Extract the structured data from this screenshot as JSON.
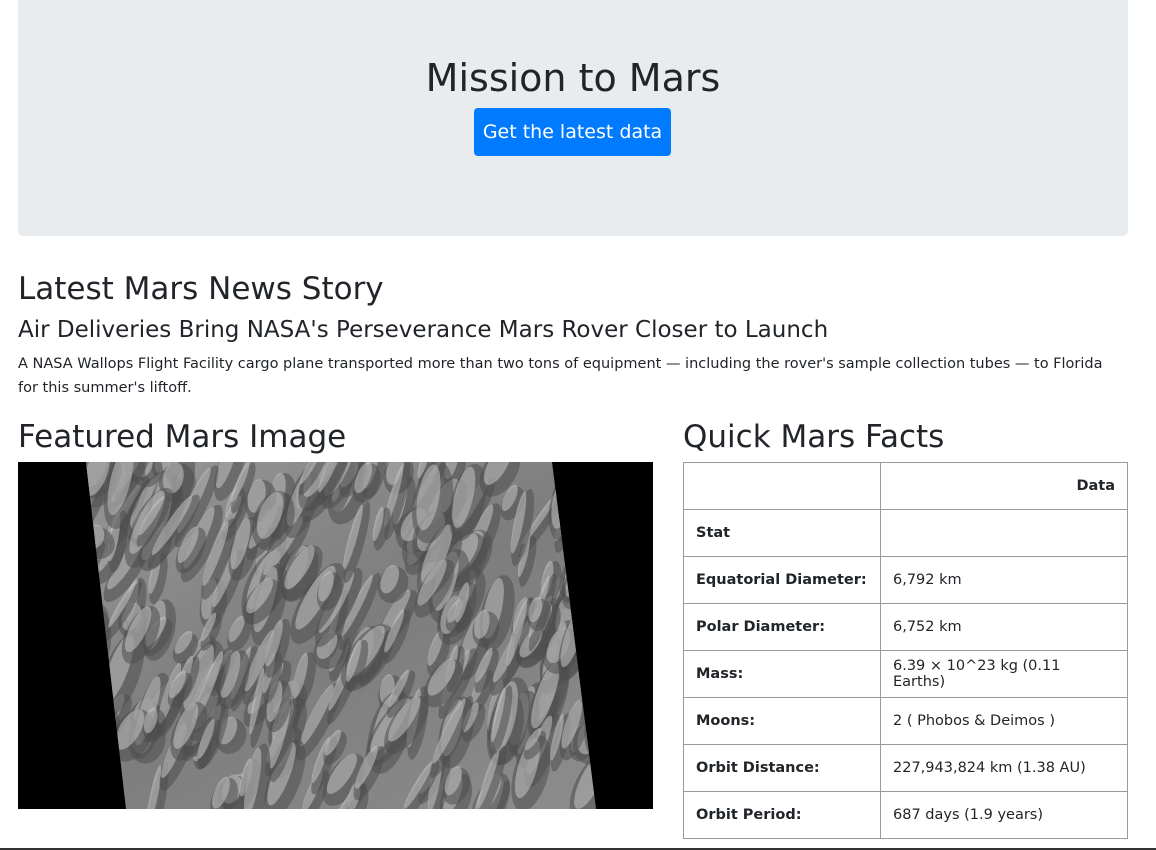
{
  "jumbotron": {
    "title": "Mission to Mars",
    "button_label": "Get the latest data"
  },
  "news": {
    "section_title": "Latest Mars News Story",
    "headline": "Air Deliveries Bring NASA's Perseverance Mars Rover Closer to Launch",
    "paragraph": "A NASA Wallops Flight Facility cargo plane transported more than two tons of equipment — including the rover's sample collection tubes — to Florida for this summer's liftoff."
  },
  "featured_image": {
    "section_title": "Featured Mars Image",
    "subject": "grayscale Mars sand dune field on black background"
  },
  "facts": {
    "section_title": "Quick Mars Facts",
    "header_col1": "",
    "header_col2": "Data",
    "stat_label": "Stat",
    "stat_value": "",
    "rows": [
      {
        "label": "Equatorial Diameter:",
        "value": "6,792 km"
      },
      {
        "label": "Polar Diameter:",
        "value": "6,752 km"
      },
      {
        "label": "Mass:",
        "value": "6.39 × 10^23 kg (0.11 Earths)"
      },
      {
        "label": "Moons:",
        "value": "2 ( Phobos & Deimos )"
      },
      {
        "label": "Orbit Distance:",
        "value": "227,943,824 km (1.38 AU)"
      },
      {
        "label": "Orbit Period:",
        "value": "687 days (1.9 years)"
      }
    ]
  },
  "colors": {
    "primary": "#007bff",
    "jumbotron_bg": "#e9ecef",
    "text": "#212529"
  }
}
